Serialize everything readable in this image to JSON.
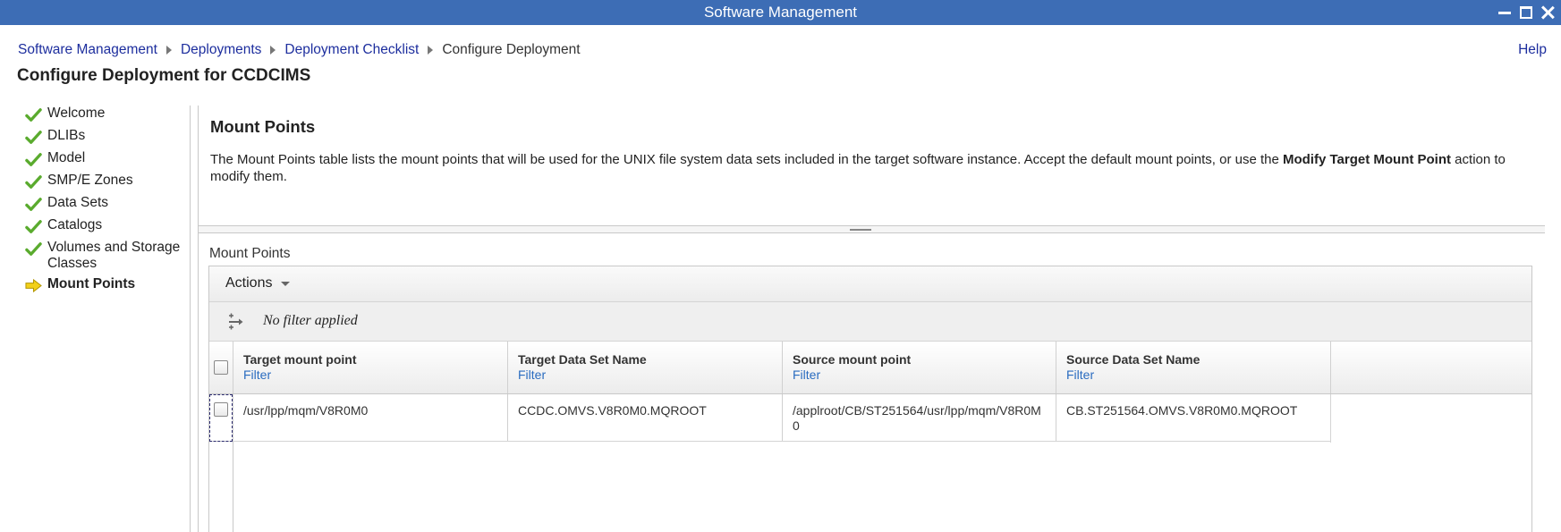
{
  "window": {
    "title": "Software Management"
  },
  "breadcrumb": {
    "items": [
      "Software Management",
      "Deployments",
      "Deployment Checklist"
    ],
    "current": "Configure Deployment"
  },
  "help_label": "Help",
  "page_title": "Configure Deployment for CCDCIMS",
  "sidebar": {
    "items": [
      {
        "label": "Welcome",
        "status": "complete"
      },
      {
        "label": "DLIBs",
        "status": "complete"
      },
      {
        "label": "Model",
        "status": "complete"
      },
      {
        "label": "SMP/E Zones",
        "status": "complete"
      },
      {
        "label": "Data Sets",
        "status": "complete"
      },
      {
        "label": "Catalogs",
        "status": "complete"
      },
      {
        "label": "Volumes and Storage Classes",
        "status": "complete"
      },
      {
        "label": "Mount Points",
        "status": "current"
      }
    ]
  },
  "main": {
    "title": "Mount Points",
    "description_part1": "The Mount Points table lists the mount points that will be used for the UNIX file system data sets included in the target software instance.  Accept the default mount points, or use the ",
    "description_bold": "Modify Target Mount Point",
    "description_part2": " action to modify them."
  },
  "table": {
    "caption": "Mount Points",
    "actions_label": "Actions",
    "filter_status": "No filter applied",
    "filter_link": "Filter",
    "columns": [
      "Target mount point",
      "Target Data Set Name",
      "Source mount point",
      "Source Data Set Name"
    ],
    "rows": [
      {
        "target_mount_point": "/usr/lpp/mqm/V8R0M0",
        "target_data_set_name": "CCDC.OMVS.V8R0M0.MQROOT",
        "source_mount_point_line1": "/applroot/CB/ST251564/usr/lpp/mqm/V8R0M",
        "source_mount_point_line2": "0",
        "source_data_set_name": "CB.ST251564.OMVS.V8R0M0.MQROOT"
      }
    ]
  },
  "colors": {
    "titlebar": "#3d6db5",
    "link": "#1d2e9e",
    "check_green": "#5aab2e",
    "arrow_yellow": "#f2d01a"
  }
}
